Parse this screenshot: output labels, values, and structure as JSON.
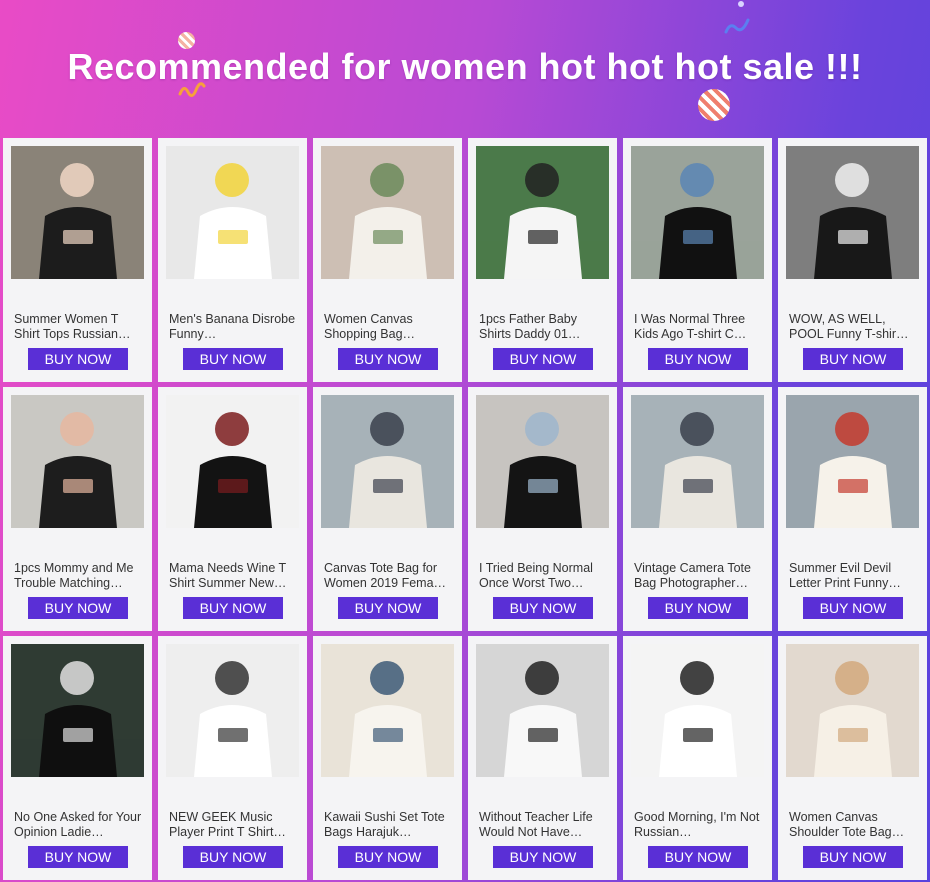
{
  "header": {
    "title": "Recommended for women hot hot hot sale !!!"
  },
  "colors": {
    "gradient_start": "#e94bc6",
    "gradient_end": "#5843de",
    "button": "#5a2fd6",
    "card": "#f4f4f6"
  },
  "products": [
    {
      "name": "Summer Women T Shirt Tops Russian…",
      "button": "BUY NOW",
      "image": "woman-black-tshirt-collage-photo"
    },
    {
      "name": "Men's Banana Disrobe Funny…",
      "button": "BUY NOW",
      "image": "man-white-tshirt-banana-photo"
    },
    {
      "name": "Women Canvas Shopping Bag…",
      "button": "BUY NOW",
      "image": "woman-canvas-bag-photo"
    },
    {
      "name": "1pcs Father Baby Shirts Daddy 01…",
      "button": "BUY NOW",
      "image": "father-baby-shirts-photo"
    },
    {
      "name": "I Was Normal Three Kids Ago T-shirt C…",
      "button": "BUY NOW",
      "image": "black-tshirt-flatlay-photo"
    },
    {
      "name": "WOW, AS WELL, POOL Funny T-shir…",
      "button": "BUY NOW",
      "image": "woman-black-tshirt-collage-photo"
    },
    {
      "name": "1pcs Mommy and Me Trouble Matching…",
      "button": "BUY NOW",
      "image": "mother-child-tshirts-photo"
    },
    {
      "name": "Mama Needs Wine T Shirt Summer New…",
      "button": "BUY NOW",
      "image": "woman-wine-tshirt-photo"
    },
    {
      "name": "Canvas Tote Bag for Women 2019 Fema…",
      "button": "BUY NOW",
      "image": "woman-tote-bag-seaside-photo"
    },
    {
      "name": "I Tried Being Normal Once Worst Two…",
      "button": "BUY NOW",
      "image": "woman-black-crop-tshirt-photo"
    },
    {
      "name": "Vintage Camera Tote Bag Photographer…",
      "button": "BUY NOW",
      "image": "woman-tote-bag-seaside-photo"
    },
    {
      "name": "Summer Evil Devil Letter Print Funny…",
      "button": "BUY NOW",
      "image": "printed-tote-bag-photo"
    },
    {
      "name": "No One Asked for Your Opinion Ladie…",
      "button": "BUY NOW",
      "image": "black-tshirt-closeup-photo"
    },
    {
      "name": "NEW GEEK Music Player Print T Shirt…",
      "button": "BUY NOW",
      "image": "man-white-tshirt-print-photo"
    },
    {
      "name": "Kawaii Sushi Set Tote Bags Harajuk…",
      "button": "BUY NOW",
      "image": "sushi-tote-bag-photo"
    },
    {
      "name": "Without Teacher Life Would Not Have…",
      "button": "BUY NOW",
      "image": "teacher-tote-bag-photo"
    },
    {
      "name": "Good Morning, I'm Not Russian…",
      "button": "BUY NOW",
      "image": "woman-white-tshirt-photo"
    },
    {
      "name": "Women Canvas Shoulder Tote Bag…",
      "button": "BUY NOW",
      "image": "woman-shoulder-tote-photo"
    }
  ]
}
